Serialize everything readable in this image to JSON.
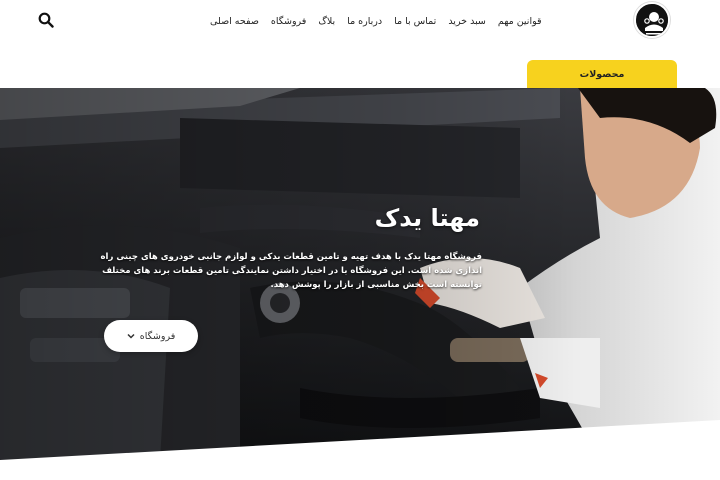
{
  "header": {
    "logo_icon": "mahtayadak-logo",
    "search_icon": "search-icon",
    "nav": [
      {
        "label": "صفحه اصلی"
      },
      {
        "label": "فروشگاه"
      },
      {
        "label": "بلاگ"
      },
      {
        "label": "درباره ما"
      },
      {
        "label": "تماس با ما"
      },
      {
        "label": "سبد خرید"
      },
      {
        "label": "قوانین مهم"
      }
    ]
  },
  "products_tab": {
    "label": "محصولات",
    "color": "#f7d21e"
  },
  "hero": {
    "title": "مهتا یدک",
    "description": "فروشگاه مهتا یدک با هدف تهیه و تامین قطعات یدکی و لوازم جانبی خودروی های چینی راه اندازی شده است. این فروشگاه با در اختیار داشتن نمایندگی تامین قطعات برند های مختلف توانسته است بخش مناسبی از بازار را پوشش دهد.",
    "button_label": "فروشگاه",
    "button_icon": "chevron-down-icon"
  }
}
